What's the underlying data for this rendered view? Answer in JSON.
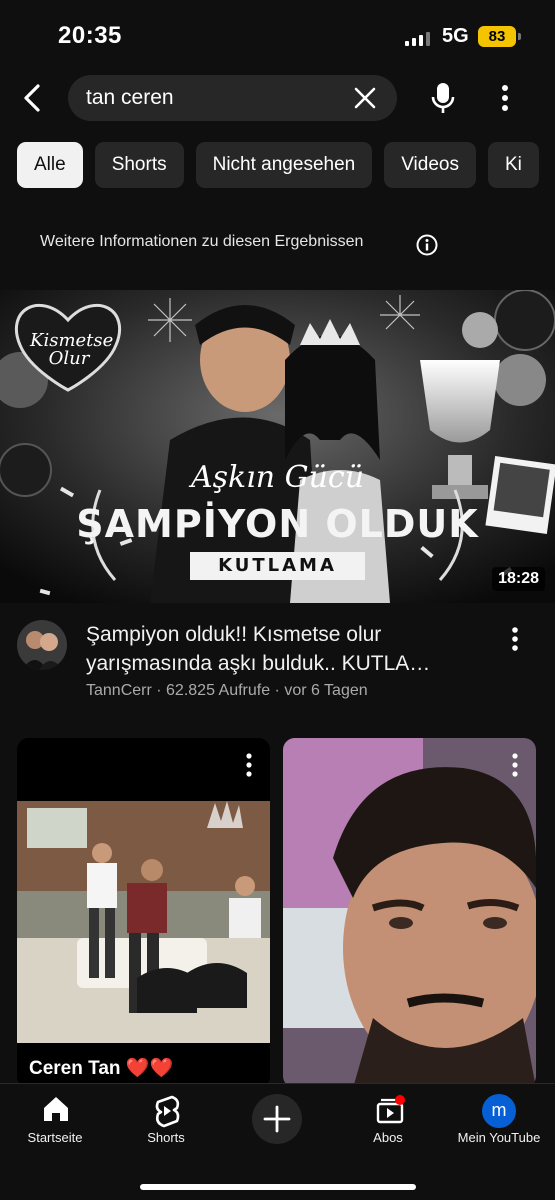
{
  "status_bar": {
    "time": "20:35",
    "network": "5G",
    "battery": "83"
  },
  "search": {
    "query": "tan ceren"
  },
  "chips": [
    "Alle",
    "Shorts",
    "Nicht angesehen",
    "Videos",
    "Ki"
  ],
  "info": {
    "text": "Weitere Informationen zu diesen Ergebnissen"
  },
  "video": {
    "thumbnail_badge": "Kismetse Olur",
    "thumbnail_script": "Aşkın Gücü",
    "thumbnail_headline": "ŞAMPİYON OLDUK",
    "thumbnail_ribbon": "KUTLAMA",
    "duration": "18:28",
    "title_line1": "Şampiyon olduk!! Kısmetse olur",
    "title_line2": "yarışmasında aşkı bulduk.. KUTLA…",
    "meta": "TannCerr · 62.825 Aufrufe · vor 6 Tagen"
  },
  "shorts": [
    {
      "caption": "Ceren Tan ❤️❤️"
    },
    {
      "caption": ""
    }
  ],
  "nav": {
    "home": "Startseite",
    "shorts": "Shorts",
    "subs": "Abos",
    "me": "Mein YouTube",
    "me_initial": "m"
  },
  "colors": {
    "background": "#0f0f0f",
    "chip": "#272727",
    "chip_active": "#f1f1f1",
    "accent": "#ff0000",
    "avatar": "#065fd4",
    "battery": "#f5c400"
  }
}
